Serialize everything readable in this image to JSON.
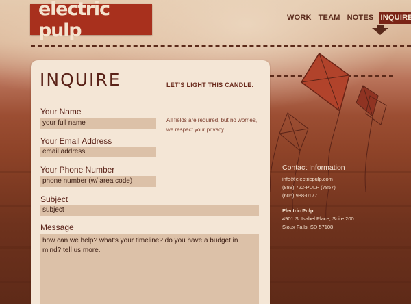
{
  "logo": {
    "text": "electric pulp"
  },
  "nav": {
    "items": [
      {
        "label": "WORK",
        "active": false
      },
      {
        "label": "TEAM",
        "active": false
      },
      {
        "label": "NOTES",
        "active": false
      },
      {
        "label": "INQUIRE",
        "active": true
      }
    ]
  },
  "page": {
    "title": "INQUIRE",
    "tagline": "LET'S LIGHT THIS CANDLE.",
    "note": "All fields are required, but no worries, we respect your privacy."
  },
  "form": {
    "name": {
      "label": "Your Name",
      "value": "your full name"
    },
    "email": {
      "label": "Your Email Address",
      "value": "email address"
    },
    "phone": {
      "label": "Your Phone Number",
      "value": "phone number (w/ area code)"
    },
    "subject": {
      "label": "Subject",
      "value": "subject"
    },
    "message": {
      "label": "Message",
      "value": "how can we help?  what's your timeline?  do you have a budget in mind?  tell us more."
    }
  },
  "contact": {
    "heading": "Contact Information",
    "email": "info@electricpulp.com",
    "phone1": "(888) 722-PULP (7857)",
    "phone2": "(605) 988-0177",
    "company": "Electric Pulp",
    "address1": "4901 S. Isabel Place, Suite 200",
    "address2": "Sioux Falls, SD 57108"
  },
  "colors": {
    "brand": "#a8301d",
    "nav_active": "#7a2416",
    "panel": "#f4e6d6",
    "field": "#dcc1a8"
  }
}
